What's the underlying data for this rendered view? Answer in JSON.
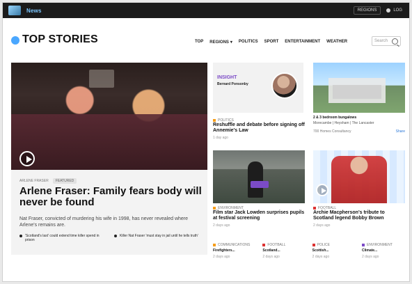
{
  "topbar": {
    "brand": "News",
    "region_button": "REGIONS",
    "login": "LOG"
  },
  "header": {
    "title": "TOP STORIES",
    "nav": [
      "TOP",
      "REGIONS",
      "POLITICS",
      "SPORT",
      "ENTERTAINMENT",
      "WEATHER"
    ],
    "search_placeholder": "Search"
  },
  "main_story": {
    "tags": [
      "ARLENE FRASER",
      "FEATURED"
    ],
    "headline": "Arlene Fraser: Family fears body will never be found",
    "standfirst": "Nat Fraser, convicted of murdering his wife in 1998, has never revealed where Arlene's remains are.",
    "related": [
      "'Scotland's last' could extend time killer spend in prison",
      "Killer Nat Fraser 'must stay in jail until he tells truth'"
    ]
  },
  "insight": {
    "label": "INSIGHT",
    "name": "Bernard Ponsonby"
  },
  "story_top_left": {
    "category": "POLITICS",
    "title": "Reshuffle and debate before signing off Annemie's Law",
    "time": "1 day ago"
  },
  "story_top_right": {
    "title": "2 & 3 bedroom bungalows",
    "sub": "Morecambe | Heysham | The Lancaster",
    "footer_left": "700 Homes Consultancy",
    "share": "Share"
  },
  "story_mid_left": {
    "category": "ENVIRONMENT",
    "title": "Film star Jack Lowden surprises pupils at festival screening",
    "time": "2 days ago"
  },
  "story_mid_right": {
    "category": "FOOTBALL",
    "title": "Archie Macpherson's tribute to Scotland legend Bobby Brown",
    "time": "2 days ago"
  },
  "bottom_items": [
    {
      "category": "COMMUNICATIONS",
      "title": "Firefighters...",
      "time": "2 days ago"
    },
    {
      "category": "FOOTBALL",
      "title": "Scotland...",
      "time": "2 days ago"
    },
    {
      "category": "POLICE",
      "title": "Scottish...",
      "time": "2 days ago"
    },
    {
      "category": "ENVIRONMENT",
      "title": "Climate...",
      "time": "2 days ago"
    }
  ],
  "colors": {
    "topbar_bg": "#1b1b1b",
    "accent_blue": "#4aa7ff",
    "insight_purple": "#7c4bc7",
    "category_orange": "#f59d1a",
    "category_red": "#d33333",
    "accent_line": "#2aa8c7"
  },
  "icons": {
    "brand_logo": "news-logo-icon",
    "user": "user-icon",
    "search": "search-icon",
    "play": "play-icon"
  }
}
